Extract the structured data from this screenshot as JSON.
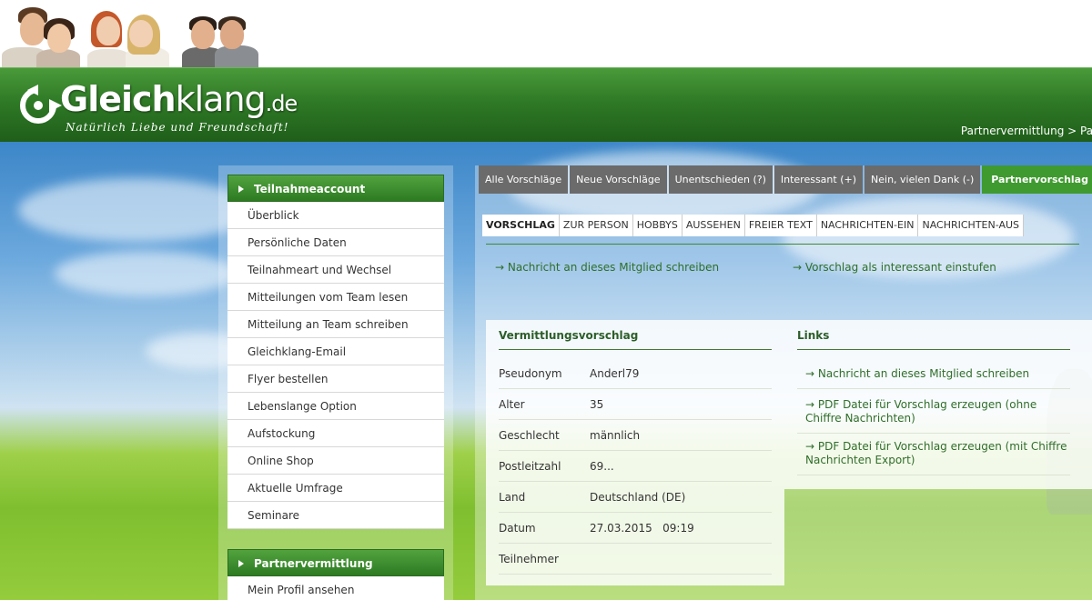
{
  "header": {
    "logo_bold": "Gleich",
    "logo_light": "klang",
    "logo_tld": ".de",
    "tagline": "Natürlich Liebe und Freundschaft!",
    "breadcrumb": "Partnervermittlung > Par"
  },
  "colors": {
    "brand_green": "#2f7a26",
    "tab_gray": "#6b6b6b",
    "tab_active": "#3f9a2f",
    "link_green": "#2f6e2a"
  },
  "sidebar": {
    "account_title": "Teilnahmeaccount",
    "account_items": [
      "Überblick",
      "Persönliche Daten",
      "Teilnahmeart und Wechsel",
      "Mitteilungen vom Team lesen",
      "Mitteilung an Team schreiben",
      "Gleichklang-Email",
      "Flyer bestellen",
      "Lebenslange Option",
      "Aufstockung",
      "Online Shop",
      "Aktuelle Umfrage",
      "Seminare"
    ],
    "partner_title": "Partnervermittlung",
    "partner_items": [
      "Mein Profil ansehen"
    ]
  },
  "top_tabs": [
    "Alle Vorschläge",
    "Neue Vorschläge",
    "Unentschieden (?)",
    "Interessant (+)",
    "Nein, vielen Dank (-)",
    "Partnervorschlag"
  ],
  "sub_tabs": [
    "VORSCHLAG",
    "ZUR PERSON",
    "HOBBYS",
    "AUSSEHEN",
    "FREIER TEXT",
    "NACHRICHTEN-EIN",
    "NACHRICHTEN-AUS"
  ],
  "actions": {
    "write_message": "→ Nachricht an dieses Mitglied schreiben",
    "mark_interesting": "→ Vorschlag als interessant einstufen"
  },
  "details": {
    "title": "Vermittlungsvorschlag",
    "rows": [
      {
        "key": "Pseudonym",
        "value": "Anderl79"
      },
      {
        "key": "Alter",
        "value": "35"
      },
      {
        "key": "Geschlecht",
        "value": "männlich"
      },
      {
        "key": "Postleitzahl",
        "value": "69..."
      },
      {
        "key": "Land",
        "value": "Deutschland (DE)"
      },
      {
        "key": "Datum",
        "value": "27.03.2015   09:19"
      },
      {
        "key": "Teilnehmer",
        "value": ""
      }
    ]
  },
  "links": {
    "title": "Links",
    "items": [
      "→ Nachricht an dieses Mitglied schreiben",
      "→ PDF Datei für Vorschlag erzeugen (ohne Chiffre Nachrichten)",
      "→ PDF Datei für Vorschlag erzeugen (mit Chiffre Nachrichten Export)"
    ]
  }
}
